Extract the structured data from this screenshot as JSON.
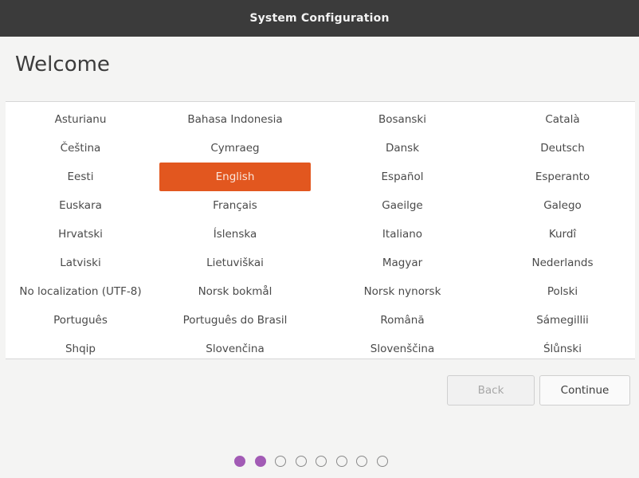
{
  "window": {
    "title": "System Configuration"
  },
  "page": {
    "heading": "Welcome"
  },
  "languages": [
    "Asturianu",
    "Bahasa Indonesia",
    "Bosanski",
    "Català",
    "Čeština",
    "Cymraeg",
    "Dansk",
    "Deutsch",
    "Eesti",
    "English",
    "Español",
    "Esperanto",
    "Euskara",
    "Français",
    "Gaeilge",
    "Galego",
    "Hrvatski",
    "Íslenska",
    "Italiano",
    "Kurdî",
    "Latviski",
    "Lietuviškai",
    "Magyar",
    "Nederlands",
    "No localization (UTF-8)",
    "Norsk bokmål",
    "Norsk nynorsk",
    "Polski",
    "Português",
    "Português do Brasil",
    "Română",
    "Sámegillii",
    "Shqip",
    "Slovenčina",
    "Slovenščina",
    "Ślůnski"
  ],
  "selected_language": "English",
  "buttons": {
    "back_label": "Back",
    "back_enabled": false,
    "continue_label": "Continue"
  },
  "progress": {
    "total_steps": 8,
    "current_step": 2
  },
  "colors": {
    "accent": "#e2571f",
    "progress_dot": "#a25bb5",
    "titlebar": "#3b3b3b"
  }
}
